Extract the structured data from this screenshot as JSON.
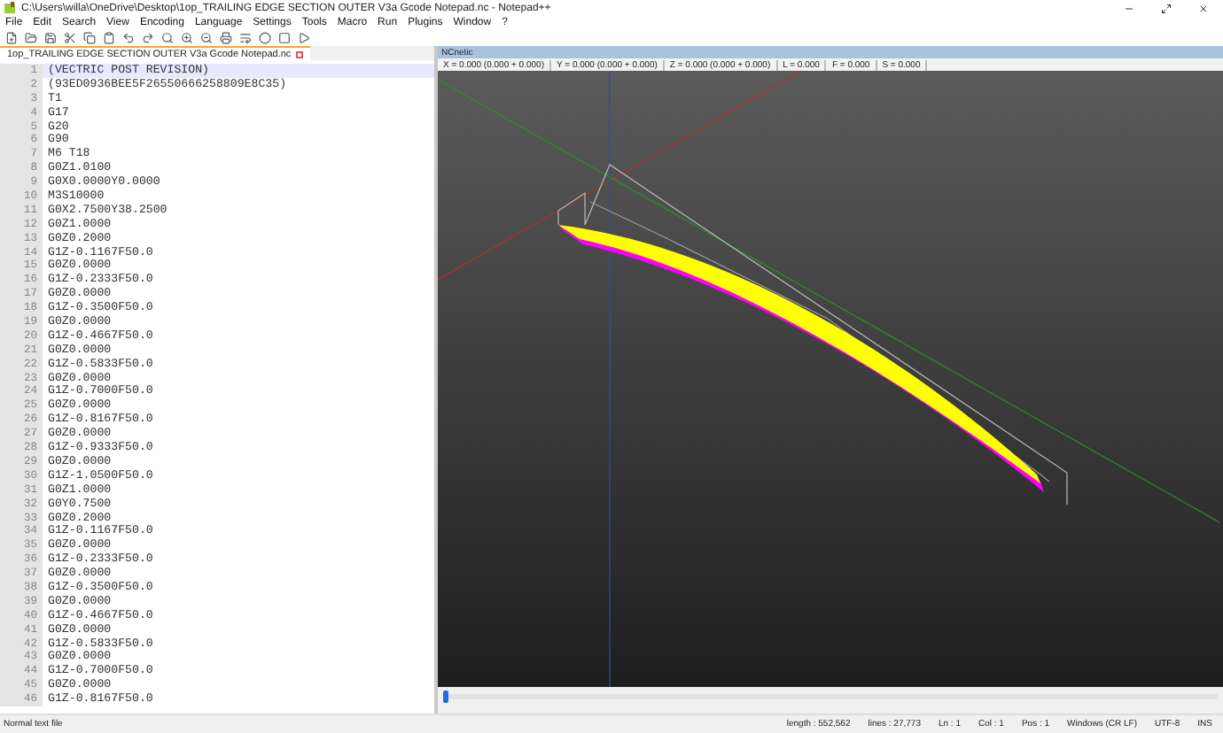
{
  "window": {
    "title": "C:\\Users\\willa\\OneDrive\\Desktop\\1op_TRAILING EDGE SECTION OUTER V3a Gcode Notepad.nc - Notepad++"
  },
  "menu": [
    "File",
    "Edit",
    "Search",
    "View",
    "Encoding",
    "Language",
    "Settings",
    "Tools",
    "Macro",
    "Run",
    "Plugins",
    "Window",
    "?"
  ],
  "tabs": [
    {
      "label": "1op_TRAILING EDGE SECTION OUTER V3a Gcode Notepad.nc",
      "selected": true
    }
  ],
  "editor": {
    "lines": [
      {
        "number": "1",
        "text": "(VECTRIC POST REVISION)",
        "selected": true
      },
      {
        "number": "2",
        "text": "(93ED0936BEE5F26550666258809E8C35)",
        "selected": false
      },
      {
        "number": "3",
        "text": "T1",
        "selected": false
      },
      {
        "number": "4",
        "text": "G17",
        "selected": false
      },
      {
        "number": "5",
        "text": "G20",
        "selected": false
      },
      {
        "number": "6",
        "text": "G90",
        "selected": false
      },
      {
        "number": "7",
        "text": "M6 T18",
        "selected": false
      },
      {
        "number": "8",
        "text": "G0Z1.0100",
        "selected": false
      },
      {
        "number": "9",
        "text": "G0X0.0000Y0.0000",
        "selected": false
      },
      {
        "number": "10",
        "text": "M3S10000",
        "selected": false
      },
      {
        "number": "11",
        "text": "G0X2.7500Y38.2500",
        "selected": false
      },
      {
        "number": "12",
        "text": "G0Z1.0000",
        "selected": false
      },
      {
        "number": "13",
        "text": "G0Z0.2000",
        "selected": false
      },
      {
        "number": "14",
        "text": "G1Z-0.1167F50.0",
        "selected": false
      },
      {
        "number": "15",
        "text": "G0Z0.0000",
        "selected": false
      },
      {
        "number": "16",
        "text": "G1Z-0.2333F50.0",
        "selected": false
      },
      {
        "number": "17",
        "text": "G0Z0.0000",
        "selected": false
      },
      {
        "number": "18",
        "text": "G1Z-0.3500F50.0",
        "selected": false
      },
      {
        "number": "19",
        "text": "G0Z0.0000",
        "selected": false
      },
      {
        "number": "20",
        "text": "G1Z-0.4667F50.0",
        "selected": false
      },
      {
        "number": "21",
        "text": "G0Z0.0000",
        "selected": false
      },
      {
        "number": "22",
        "text": "G1Z-0.5833F50.0",
        "selected": false
      },
      {
        "number": "23",
        "text": "G0Z0.0000",
        "selected": false
      },
      {
        "number": "24",
        "text": "G1Z-0.7000F50.0",
        "selected": false
      },
      {
        "number": "25",
        "text": "G0Z0.0000",
        "selected": false
      },
      {
        "number": "26",
        "text": "G1Z-0.8167F50.0",
        "selected": false
      },
      {
        "number": "27",
        "text": "G0Z0.0000",
        "selected": false
      },
      {
        "number": "28",
        "text": "G1Z-0.9333F50.0",
        "selected": false
      },
      {
        "number": "29",
        "text": "G0Z0.0000",
        "selected": false
      },
      {
        "number": "30",
        "text": "G1Z-1.0500F50.0",
        "selected": false
      },
      {
        "number": "31",
        "text": "G0Z1.0000",
        "selected": false
      },
      {
        "number": "32",
        "text": "G0Y0.7500",
        "selected": false
      },
      {
        "number": "33",
        "text": "G0Z0.2000",
        "selected": false
      },
      {
        "number": "34",
        "text": "G1Z-0.1167F50.0",
        "selected": false
      },
      {
        "number": "35",
        "text": "G0Z0.0000",
        "selected": false
      },
      {
        "number": "36",
        "text": "G1Z-0.2333F50.0",
        "selected": false
      },
      {
        "number": "37",
        "text": "G0Z0.0000",
        "selected": false
      },
      {
        "number": "38",
        "text": "G1Z-0.3500F50.0",
        "selected": false
      },
      {
        "number": "39",
        "text": "G0Z0.0000",
        "selected": false
      },
      {
        "number": "40",
        "text": "G1Z-0.4667F50.0",
        "selected": false
      },
      {
        "number": "41",
        "text": "G0Z0.0000",
        "selected": false
      },
      {
        "number": "42",
        "text": "G1Z-0.5833F50.0",
        "selected": false
      },
      {
        "number": "43",
        "text": "G0Z0.0000",
        "selected": false
      },
      {
        "number": "44",
        "text": "G1Z-0.7000F50.0",
        "selected": false
      },
      {
        "number": "45",
        "text": "G0Z0.0000",
        "selected": false
      },
      {
        "number": "46",
        "text": "G1Z-0.8167F50.0",
        "selected": false
      }
    ]
  },
  "viewer": {
    "title": "NCnetic",
    "readouts": [
      "X = 0.000 (0.000 + 0.000)",
      "Y = 0.000 (0.000 + 0.000)",
      "Z = 0.000 (0.000 + 0.000)",
      "L = 0.000",
      "F = 0.000",
      "S = 0.000"
    ],
    "timeline": {
      "level": 0.0
    }
  },
  "status_bar": {
    "file_type": "Normal text file",
    "fields": [
      "length : 552,562",
      "lines : 27,773",
      "Ln : 1",
      "Col : 1",
      "Pos : 1",
      "Windows (CR LF)",
      "UTF-8",
      "INS"
    ]
  }
}
